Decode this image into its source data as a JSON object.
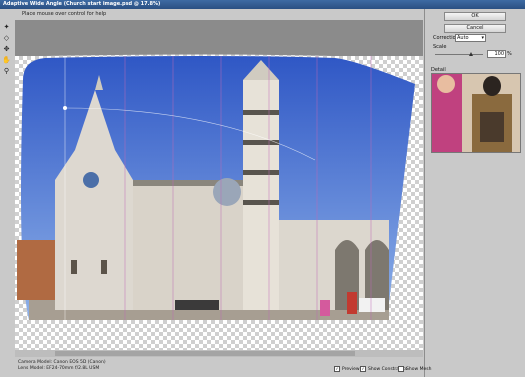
{
  "window": {
    "title": "Adaptive Wide Angle (Church start image.psd @ 17.8%)"
  },
  "hint": "Place mouse over control for help",
  "tools": [
    {
      "name": "constraint-tool-icon"
    },
    {
      "name": "polygon-constraint-tool-icon"
    },
    {
      "name": "move-tool-icon"
    },
    {
      "name": "hand-tool-icon"
    },
    {
      "name": "zoom-tool-icon"
    }
  ],
  "panel": {
    "ok_label": "OK",
    "cancel_label": "Cancel",
    "correction_label": "Correction:",
    "correction_value": "Auto",
    "scale_label": "Scale",
    "scale_value": "100",
    "scale_unit": "%",
    "scale_level": 0.75,
    "detail_label": "Detail"
  },
  "status": {
    "camera_model": "Camera Model: Canon EOS 5D (Canon)",
    "lens_model": "Lens Model: EF24-70mm f/2.8L USM"
  },
  "options": [
    {
      "label": "Preview",
      "checked": true
    },
    {
      "label": "Show Constraints",
      "checked": true
    },
    {
      "label": "Show Mesh",
      "checked": false
    }
  ],
  "colors": {
    "titlebar": "#2f5a92",
    "sky": "#4a6fd0",
    "constraint_line": "#c06ab8"
  }
}
